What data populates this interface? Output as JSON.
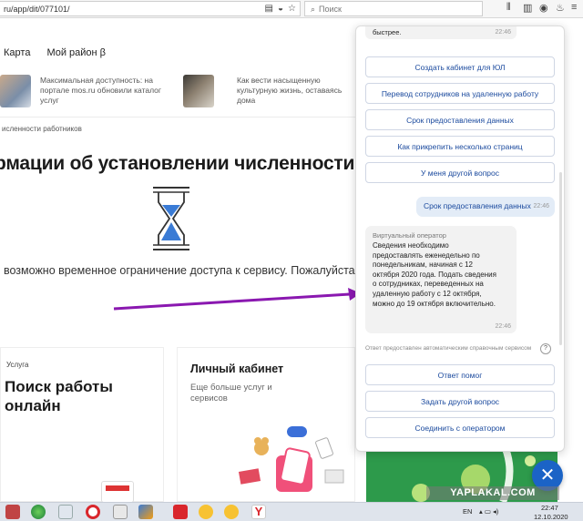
{
  "browser": {
    "url": "ru/app/dit/077101/",
    "search_placeholder": "Поиск"
  },
  "nav": {
    "items": [
      "Карта",
      "Мой район β"
    ]
  },
  "news": [
    {
      "text": "Максимальная доступность: на портале mos.ru обновили каталог услуг"
    },
    {
      "text": "Как вести насыщенную культурную жизнь, оставаясь дома"
    }
  ],
  "breadcrumb": "исленности работников",
  "page": {
    "title": "рмации об установлении численности",
    "notice": "возможно временное ограничение доступа к сервису. Пожалуйста, по"
  },
  "cards": {
    "left": {
      "label": "Услуга",
      "title": "Поиск работы онлайн"
    },
    "middle": {
      "title": "Личный кабинет",
      "subtitle": "Еще больше услуг и сервисов"
    }
  },
  "chat": {
    "top_message": {
      "text": "быстрее.",
      "time": "22:46"
    },
    "options": [
      "Создать кабинет для ЮЛ",
      "Перевод сотрудников на удаленную работу",
      "Срок предоставления данных",
      "Как прикрепить несколько страниц",
      "У меня другой вопрос"
    ],
    "user_message": {
      "text": "Срок предоставления данных",
      "time": "22:46"
    },
    "bot_message": {
      "sender": "Виртуальный оператор",
      "text": "Сведения необходимо предоставлять еженедельно по понедельникам, начиная с 12 октября 2020 года. Подать сведения о сотрудниках, переведенных на удаленную работу с 12 октября, можно до 19 октября включительно.",
      "time": "22:46"
    },
    "auto_note": "Ответ предоставлен автоматическим справочным сервисом",
    "help_icon": "?",
    "actions": [
      "Ответ помог",
      "Задать другой вопрос",
      "Соединить с оператором"
    ],
    "accent_color": "#1b63c6"
  },
  "taskbar": {
    "lang": "EN",
    "time": "22:47",
    "date": "12.10.2020"
  },
  "watermark": "YAPLAKAL.COM"
}
